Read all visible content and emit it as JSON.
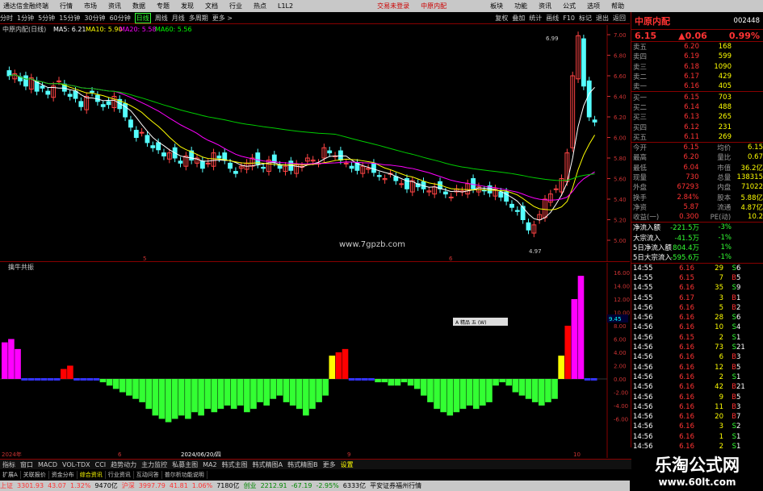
{
  "menubar": {
    "items": [
      "通达信金融终端",
      "行情",
      "市场",
      "资讯",
      "数据",
      "专题",
      "发现",
      "文档",
      "行业",
      "热点",
      "L1L2",
      "交易未登录",
      "中原内配",
      "板块",
      "功能",
      "资讯",
      "公式",
      "选项",
      "帮助"
    ]
  },
  "timeframes": {
    "items": [
      "分时",
      "1分钟",
      "5分钟",
      "15分钟",
      "30分钟",
      "60分钟",
      "日线",
      "周线",
      "月线",
      "多周期",
      "更多 >"
    ],
    "active": "日线"
  },
  "toolbar_right": [
    "复权",
    "叠加",
    "统计",
    "画线",
    "F10",
    "标记",
    "退出",
    "返回"
  ],
  "main_legend": {
    "title": "中原内配(日线)",
    "ma5": "MA5: 6.21",
    "ma10": "MA10: 5.90",
    "ma20": "MA20: 5.58",
    "ma60": "MA60: 5.56"
  },
  "y_axis_main": [
    "7.00",
    "6.80",
    "6.60",
    "6.40",
    "6.20",
    "6.00",
    "5.80",
    "5.60",
    "5.40",
    "5.20",
    "5.00"
  ],
  "y_axis_ind": [
    "16.00",
    "14.00",
    "12.00",
    "10.00",
    "8.00",
    "6.00",
    "4.00",
    "2.00",
    "0.00",
    "-2.00",
    "-4.00",
    "-6.00"
  ],
  "annot": {
    "high": "6.99",
    "low": "4.97",
    "site": "www.7gpzb.com",
    "m5": "5",
    "m6": "6",
    "date": "2024/06/20/四",
    "m9": "9",
    "m10": "10",
    "year": "2024年",
    "tip": "A 精品 五 (W)",
    "val": "9.45"
  },
  "ind_title": "擒牛共振",
  "stock": {
    "name": "中原内配",
    "code": "002448",
    "price": "6.15",
    "chg": "▲0.06",
    "pct": "0.99%"
  },
  "asks": [
    [
      "卖五",
      "6.20",
      "168"
    ],
    [
      "卖四",
      "6.19",
      "599"
    ],
    [
      "卖三",
      "6.18",
      "1090"
    ],
    [
      "卖二",
      "6.17",
      "429"
    ],
    [
      "卖一",
      "6.16",
      "405"
    ]
  ],
  "bids": [
    [
      "买一",
      "6.15",
      "703"
    ],
    [
      "买二",
      "6.14",
      "488"
    ],
    [
      "买三",
      "6.13",
      "265"
    ],
    [
      "买四",
      "6.12",
      "231"
    ],
    [
      "买五",
      "6.11",
      "269"
    ]
  ],
  "stats": [
    [
      "今开",
      "6.15",
      "均价",
      "6.15"
    ],
    [
      "最高",
      "6.20",
      "量比",
      "0.67"
    ],
    [
      "最低",
      "6.04",
      "市值",
      "36.2亿"
    ],
    [
      "现量",
      "730",
      "总量",
      "138315"
    ],
    [
      "外盘",
      "67293",
      "内盘",
      "71022"
    ],
    [
      "换手",
      "2.84%",
      "股本",
      "5.88亿"
    ],
    [
      "净资",
      "5.87",
      "流通",
      "4.87亿"
    ],
    [
      "收益(一)",
      "0.300",
      "PE(动)",
      "10.2"
    ]
  ],
  "flows": [
    [
      "净流入额",
      "-221.5万",
      "-3%"
    ],
    [
      "大宗流入",
      "-41.5万",
      "-1%"
    ],
    [
      "5日净流入额",
      "804.4万",
      "1%"
    ],
    [
      "5日大宗流入",
      "-595.6万",
      "-1%"
    ]
  ],
  "ticks": [
    [
      "14:55",
      "6.16",
      "29",
      "S",
      "6"
    ],
    [
      "14:55",
      "6.15",
      "7",
      "B",
      "5"
    ],
    [
      "14:55",
      "6.16",
      "35",
      "S",
      "9"
    ],
    [
      "14:55",
      "6.17",
      "3",
      "B",
      "1"
    ],
    [
      "14:56",
      "6.16",
      "5",
      "B",
      "2"
    ],
    [
      "14:56",
      "6.16",
      "28",
      "S",
      "6"
    ],
    [
      "14:56",
      "6.16",
      "10",
      "S",
      "4"
    ],
    [
      "14:56",
      "6.15",
      "2",
      "S",
      "1"
    ],
    [
      "14:56",
      "6.16",
      "73",
      "S",
      "21"
    ],
    [
      "14:56",
      "6.16",
      "6",
      "B",
      "3"
    ],
    [
      "14:56",
      "6.16",
      "12",
      "B",
      "5"
    ],
    [
      "14:56",
      "6.16",
      "2",
      "S",
      "1"
    ],
    [
      "14:56",
      "6.16",
      "42",
      "B",
      "21"
    ],
    [
      "14:56",
      "6.16",
      "9",
      "B",
      "5"
    ],
    [
      "14:56",
      "6.16",
      "11",
      "B",
      "3"
    ],
    [
      "14:56",
      "6.16",
      "20",
      "B",
      "7"
    ],
    [
      "14:56",
      "6.16",
      "3",
      "S",
      "2"
    ],
    [
      "14:56",
      "6.16",
      "1",
      "S",
      "1"
    ],
    [
      "14:56",
      "6.16",
      "2",
      "S",
      "1"
    ],
    [
      "14:56",
      "6.16",
      "5",
      "S",
      "3"
    ]
  ],
  "bottom_tabs": [
    "指标",
    "窗口",
    "MACD",
    "VOL-TDX",
    "CCI",
    "趋势动力",
    "主力监控",
    "私募主图",
    "MA2",
    "韩式主图",
    "韩式精图A",
    "韩式精图B",
    "更多",
    "设置",
    "模板"
  ],
  "sub_tabs": [
    "扩展A",
    "关联报价",
    "资金分布",
    "综合资讯",
    "行业资讯",
    "互动问答",
    "普尔析功能说明"
  ],
  "status": {
    "sh": "上证",
    "shv": "3301.93",
    "shc": "43.07",
    "shp": "1.32%",
    "sha": "9470亿",
    "sz": "沪深",
    "szv": "3997.79",
    "szc": "41.81",
    "szp": "1.06%",
    "sza": "7180亿",
    "cy": "创业",
    "cyv": "2212.91",
    "cyc": "-67.19",
    "cyp": "-2.95%",
    "cya": "6333亿",
    "broker": "平安证券福州行情"
  },
  "wm": {
    "cn": "乐淘公式网",
    "url": "www.60lt.com"
  }
}
